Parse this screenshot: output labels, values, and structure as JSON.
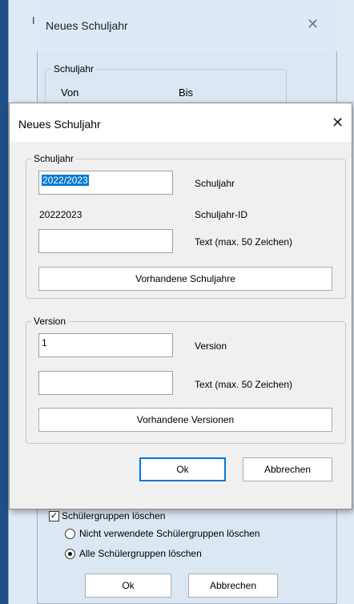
{
  "background_dialog": {
    "title": "Neues Schuljahr",
    "group_label": "Schuljahr",
    "from_label": "Von",
    "to_label": "Bis",
    "delete_groups_checkbox": {
      "label": "Schülergruppen löschen",
      "checked": true
    },
    "radio_options": [
      {
        "label": "Nicht verwendete Schülergruppen löschen",
        "selected": false
      },
      {
        "label": "Alle Schülergruppen löschen",
        "selected": true
      }
    ],
    "ok_label": "Ok",
    "cancel_label": "Abbrechen"
  },
  "dialog": {
    "title": "Neues Schuljahr",
    "schuljahr_group": {
      "label": "Schuljahr",
      "year_value": "2022/2023",
      "year_label": "Schuljahr",
      "id_value": "20222023",
      "id_label": "Schuljahr-ID",
      "text_value": "",
      "text_label": "Text (max. 50 Zeichen)",
      "existing_button": "Vorhandene Schuljahre"
    },
    "version_group": {
      "label": "Version",
      "version_value": "1",
      "version_label": "Version",
      "text_value": "",
      "text_label": "Text (max. 50 Zeichen)",
      "existing_button": "Vorhandene Versionen"
    },
    "ok_label": "Ok",
    "cancel_label": "Abbrechen"
  },
  "colors": {
    "accent": "#0078d7",
    "desktop_edge": "#1f4f86",
    "dialog_bg": "#f0f0f0"
  }
}
